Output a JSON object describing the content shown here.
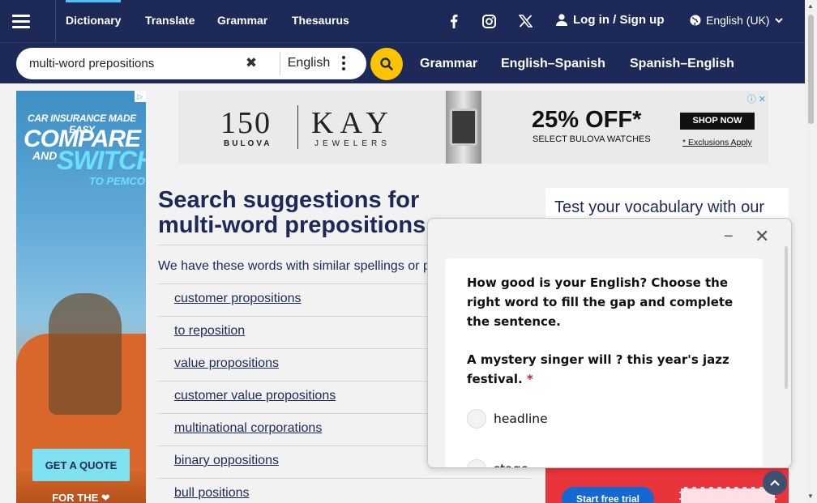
{
  "header": {
    "nav": [
      "Dictionary",
      "Translate",
      "Grammar",
      "Thesaurus"
    ],
    "login": "Log in / Sign up",
    "language": "English (UK)"
  },
  "search": {
    "value": "multi-word prepositions",
    "lang": "English",
    "sublinks": [
      "Grammar",
      "English–Spanish",
      "Spanish–English"
    ]
  },
  "left_ad": {
    "line1": "CAR INSURANCE MADE EASY",
    "line2": "COMPARE",
    "line3": "AND",
    "line4": "SWITCH",
    "line5": "TO PEMCO",
    "cta": "GET A QUOTE",
    "bottom": "FOR THE ❤"
  },
  "banner": {
    "brand1": "150",
    "brand1_sub": "BULOVA",
    "brand2": "KAY",
    "brand2_sub": "JEWELERS",
    "offer": "25% OFF*",
    "offer_sub": "SELECT BULOVA WATCHES",
    "cta": "SHOP NOW",
    "exclusions": "* Exclusions Apply"
  },
  "main": {
    "heading": "Search suggestions for",
    "heading_bold": "multi-word prepositions",
    "intro": "We have these words with similar spellings or p",
    "suggestions": [
      "customer propositions",
      "to reposition",
      "value propositions",
      "customer value propositions",
      "multinational corporations",
      "binary oppositions",
      "bull positions"
    ]
  },
  "right": {
    "card_title": "Test your vocabulary with our",
    "trial": "Start free trial"
  },
  "quiz": {
    "question": "How good is your English? Choose the right word to fill the gap and complete the sentence.",
    "sentence": "A mystery singer will ? this year's jazz festival.",
    "required": "*",
    "options": [
      "headline",
      "stage"
    ]
  }
}
